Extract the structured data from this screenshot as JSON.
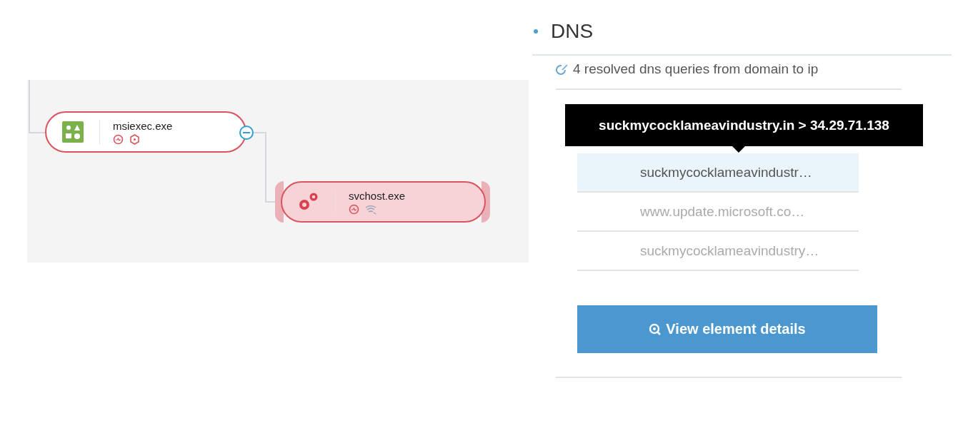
{
  "process_tree": {
    "nodes": [
      {
        "name": "msiexec.exe",
        "kind": "installer",
        "selected": false,
        "expanded": true,
        "children": [
          {
            "name": "svchost.exe",
            "kind": "service",
            "selected": true
          }
        ]
      }
    ]
  },
  "dns": {
    "title": "DNS",
    "summary": "4 resolved dns queries from domain to ip",
    "tooltip": "suckmycocklameavindustry.in > 34.29.71.138",
    "rows": [
      {
        "label": "suckmycocklameavindustr…",
        "selected": true
      },
      {
        "label": "www.update.microsoft.co…",
        "selected": false
      },
      {
        "label": "suckmycocklameavindustry…",
        "selected": false
      }
    ],
    "button": "View element details"
  }
}
